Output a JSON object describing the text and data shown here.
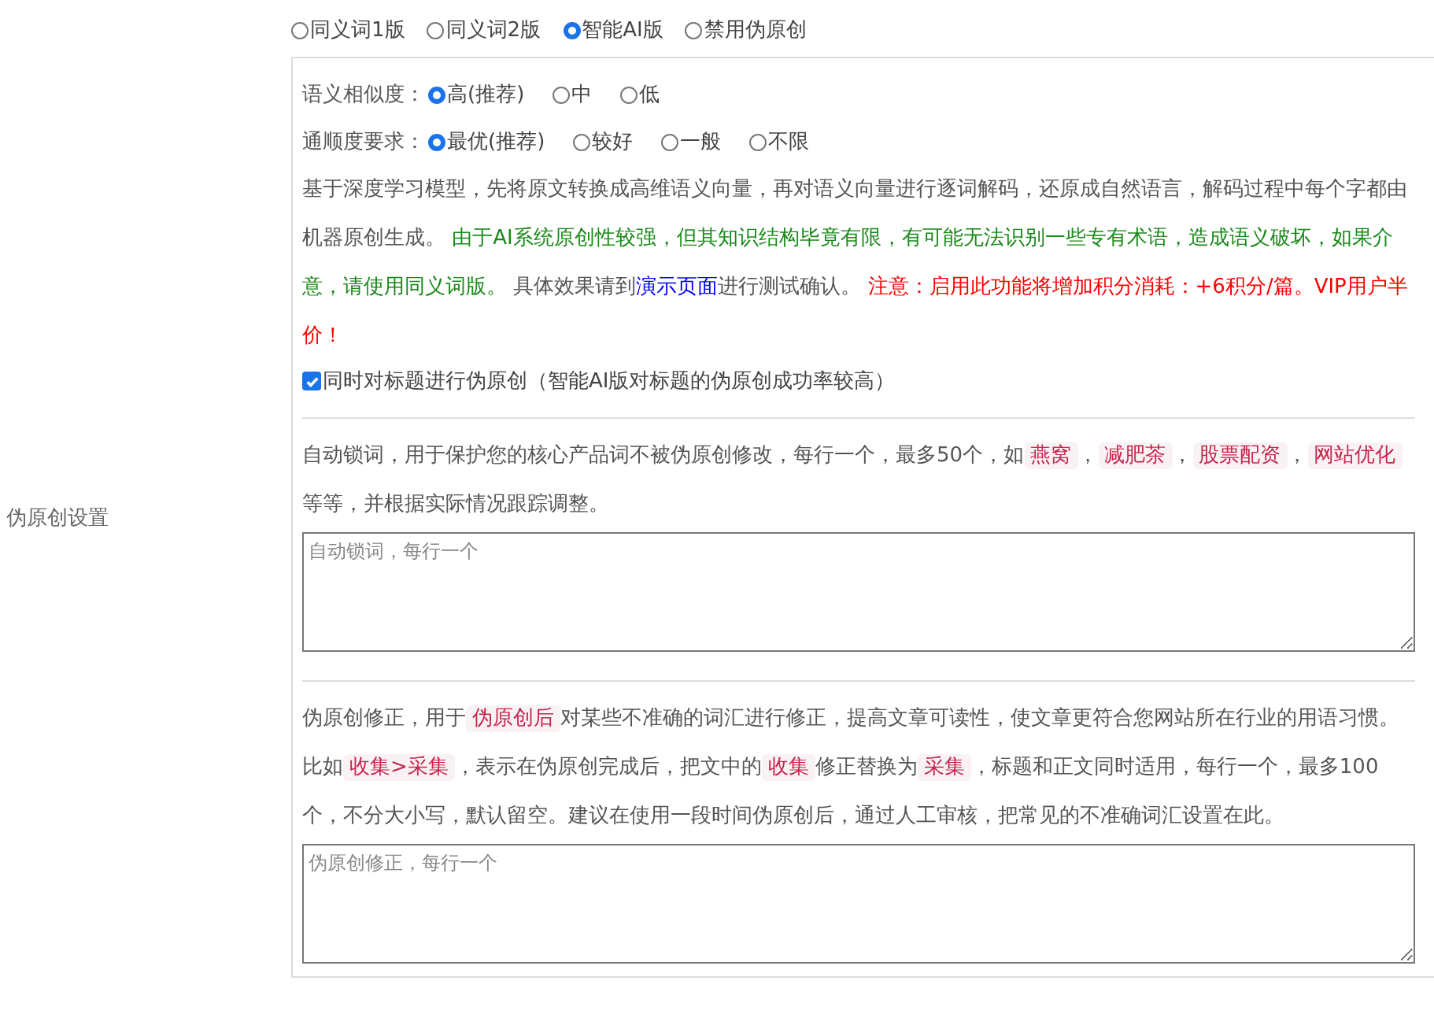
{
  "setting_label": "伪原创设置",
  "modes": [
    {
      "label": "同义词1版",
      "selected": false
    },
    {
      "label": "同义词2版",
      "selected": false
    },
    {
      "label": "智能AI版",
      "selected": true
    },
    {
      "label": "禁用伪原创",
      "selected": false
    }
  ],
  "option_groups": [
    {
      "label": "语义相似度：",
      "options": [
        {
          "label": "高(推荐)",
          "selected": true
        },
        {
          "label": "中",
          "selected": false
        },
        {
          "label": "低",
          "selected": false
        }
      ]
    },
    {
      "label": "通顺度要求：",
      "options": [
        {
          "label": "最优(推荐)",
          "selected": true
        },
        {
          "label": "较好",
          "selected": false
        },
        {
          "label": "一般",
          "selected": false
        },
        {
          "label": "不限",
          "selected": false
        }
      ]
    }
  ],
  "description": [
    {
      "kind": "plain",
      "text": "基于深度学习模型，先将原文转换成高维语义向量，再对语义向量进行逐词解码，还原成自然语言，解码过程中每个字都由机器原创生成。 "
    },
    {
      "kind": "green",
      "text": "由于AI系统原创性较强，但其知识结构毕竟有限，有可能无法识别一些专有术语，造成语义破坏，如果介意，请使用同义词版。"
    },
    {
      "kind": "plain",
      "text": " 具体效果请到"
    },
    {
      "kind": "link",
      "text": "演示页面"
    },
    {
      "kind": "plain",
      "text": "进行测试确认。 "
    },
    {
      "kind": "red",
      "text": "注意：启用此功能将增加积分消耗：+6积分/篇。VIP用户半价！"
    }
  ],
  "title_checkbox": {
    "label": "同时对标题进行伪原创（智能AI版对标题的伪原创成功率较高）",
    "checked": true
  },
  "lock_words": {
    "description": [
      {
        "kind": "plain",
        "text": "自动锁词，用于保护您的核心产品词不被伪原创修改，每行一个，最多50个，如"
      },
      {
        "kind": "code",
        "text": "燕窝"
      },
      {
        "kind": "plain",
        "text": "，"
      },
      {
        "kind": "code",
        "text": "减肥茶"
      },
      {
        "kind": "plain",
        "text": "，"
      },
      {
        "kind": "code",
        "text": "股票配资"
      },
      {
        "kind": "plain",
        "text": "，"
      },
      {
        "kind": "code",
        "text": "网站优化"
      },
      {
        "kind": "plain",
        "text": " 等等，并根据实际情况跟踪调整。"
      }
    ],
    "placeholder": "自动锁词，每行一个"
  },
  "corrections": {
    "description": [
      {
        "kind": "plain",
        "text": "伪原创修正，用于"
      },
      {
        "kind": "code",
        "text": "伪原创后"
      },
      {
        "kind": "plain",
        "text": "对某些不准确的词汇进行修正，提高文章可读性，使文章更符合您网站所在行业的用语习惯。比如"
      },
      {
        "kind": "code",
        "text": "收集>采集"
      },
      {
        "kind": "plain",
        "text": "，表示在伪原创完成后，把文中的"
      },
      {
        "kind": "code",
        "text": "收集"
      },
      {
        "kind": "plain",
        "text": "修正替换为"
      },
      {
        "kind": "code",
        "text": "采集"
      },
      {
        "kind": "plain",
        "text": "，标题和正文同时适用，每行一个，最多100个，不分大小写，默认留空。建议在使用一段时间伪原创后，通过人工审核，把常见的不准确词汇设置在此。"
      }
    ],
    "placeholder": "伪原创修正，每行一个"
  }
}
